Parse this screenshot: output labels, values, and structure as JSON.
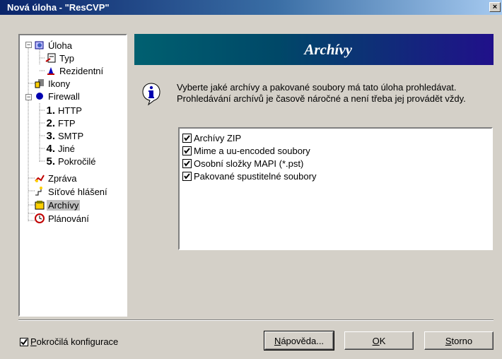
{
  "window": {
    "title": "Nová úloha - \"ResCVP\"",
    "close_label": "×"
  },
  "tree": {
    "items": [
      {
        "label": "Úloha",
        "icon": "task-icon"
      },
      {
        "label": "Typ",
        "icon": "type-icon"
      },
      {
        "label": "Rezidentní",
        "icon": "resident-icon"
      },
      {
        "label": "Ikony",
        "icon": "icons-icon"
      },
      {
        "label": "Firewall",
        "icon": "firewall-icon"
      },
      {
        "label": "HTTP",
        "num": "1."
      },
      {
        "label": "FTP",
        "num": "2."
      },
      {
        "label": "SMTP",
        "num": "3."
      },
      {
        "label": "Jiné",
        "num": "4."
      },
      {
        "label": "Pokročilé",
        "num": "5."
      },
      {
        "label": "Zpráva",
        "icon": "message-icon"
      },
      {
        "label": "Síťové hlášení",
        "icon": "network-report-icon"
      },
      {
        "label": "Archívy",
        "icon": "archive-icon",
        "selected": true
      },
      {
        "label": "Plánování",
        "icon": "schedule-icon"
      }
    ]
  },
  "header": {
    "title": "Archívy"
  },
  "description": "Vyberte jaké archívy a pakované soubory má tato úloha prohledávat. Prohledávání archívů je časově náročné a není třeba jej provádět vždy.",
  "archives": [
    {
      "label": "Archívy ZIP",
      "checked": true
    },
    {
      "label": "Mime a uu-encoded soubory",
      "checked": true
    },
    {
      "label": "Osobní složky MAPI (*.pst)",
      "checked": true
    },
    {
      "label": "Pakované spustitelné soubory",
      "checked": true
    }
  ],
  "advanced": {
    "label_first": "P",
    "label_rest": "okročilá konfigurace",
    "checked": true
  },
  "buttons": {
    "help_first": "N",
    "help_rest": "ápověda...",
    "ok_first": "O",
    "ok_rest": "K",
    "cancel_first": "S",
    "cancel_rest": "torno"
  },
  "colors": {
    "title_bar": "#0a246a",
    "header": "#004868",
    "dialog": "#d4d0c8"
  }
}
